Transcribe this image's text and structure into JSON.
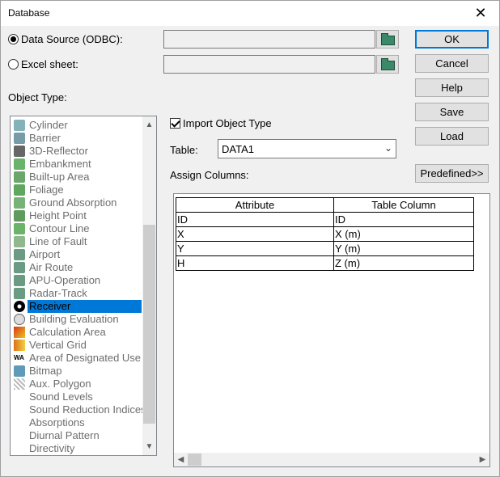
{
  "window": {
    "title": "Database"
  },
  "source": {
    "odbc_label": "Data Source (ODBC):",
    "excel_label": "Excel sheet:",
    "selected": "odbc"
  },
  "buttons": {
    "ok": "OK",
    "cancel": "Cancel",
    "help": "Help",
    "save": "Save",
    "load": "Load",
    "predefined": "Predefined>>"
  },
  "object_type": {
    "label": "Object Type:",
    "items": [
      {
        "label": "Cylinder",
        "icon": "cylinder-icon",
        "color": "#5a9aa0"
      },
      {
        "label": "Barrier",
        "icon": "barrier-icon",
        "color": "#4a7a8a"
      },
      {
        "label": "3D-Reflector",
        "icon": "3d-reflector-icon",
        "color": "#333333"
      },
      {
        "label": "Embankment",
        "icon": "embankment-icon",
        "color": "#3a9a3a"
      },
      {
        "label": "Built-up Area",
        "icon": "built-up-area-icon",
        "color": "#3a8a3a"
      },
      {
        "label": "Foliage",
        "icon": "foliage-icon",
        "color": "#2a8a2a"
      },
      {
        "label": "Ground Absorption",
        "icon": "ground-absorption-icon",
        "color": "#4a9a4a"
      },
      {
        "label": "Height Point",
        "icon": "height-point-icon",
        "color": "#2a7a2a"
      },
      {
        "label": "Contour Line",
        "icon": "contour-line-icon",
        "color": "#3a9a3a"
      },
      {
        "label": "Line of Fault",
        "icon": "line-of-fault-icon",
        "color": "#6aa06a"
      },
      {
        "label": "Airport",
        "icon": "airport-icon",
        "color": "#3a7a5a"
      },
      {
        "label": "Air Route",
        "icon": "air-route-icon",
        "color": "#3a7a5a"
      },
      {
        "label": "APU-Operation",
        "icon": "apu-operation-icon",
        "color": "#3a7a5a"
      },
      {
        "label": "Radar-Track",
        "icon": "radar-track-icon",
        "color": "#3a7a5a"
      },
      {
        "label": "Receiver",
        "icon": "receiver-icon",
        "color": "#000000"
      },
      {
        "label": "Building Evaluation",
        "icon": "building-evaluation-icon",
        "color": "#888888"
      },
      {
        "label": "Calculation Area",
        "icon": "calculation-area-icon",
        "color": "#d43a1a"
      },
      {
        "label": "Vertical Grid",
        "icon": "vertical-grid-icon",
        "color": "#e0701a"
      },
      {
        "label": "Area of Designated Use",
        "icon": "area-designated-use-icon",
        "color": "#000000"
      },
      {
        "label": "Bitmap",
        "icon": "bitmap-icon",
        "color": "#2a7aa0"
      },
      {
        "label": "Aux. Polygon",
        "icon": "aux-polygon-icon",
        "color": "#aaaaaa"
      },
      {
        "label": "Sound Levels",
        "icon": "",
        "color": ""
      },
      {
        "label": "Sound Reduction Indices",
        "icon": "",
        "color": ""
      },
      {
        "label": "Absorptions",
        "icon": "",
        "color": ""
      },
      {
        "label": "Diurnal Pattern",
        "icon": "",
        "color": ""
      },
      {
        "label": "Directivity",
        "icon": "",
        "color": ""
      }
    ],
    "selected_index": 14
  },
  "import": {
    "checkbox_label": "Import Object Type",
    "checked": true
  },
  "table": {
    "label": "Table:",
    "value": "DATA1"
  },
  "assign": {
    "label": "Assign Columns:",
    "headers": [
      "Attribute",
      "Table Column"
    ],
    "rows": [
      [
        "ID",
        "ID"
      ],
      [
        "X",
        "X (m)"
      ],
      [
        "Y",
        "Y (m)"
      ],
      [
        "H",
        "Z (m)"
      ]
    ]
  },
  "colors": {
    "accent": "#0078d7",
    "dialog_bg": "#f0f0f0"
  }
}
